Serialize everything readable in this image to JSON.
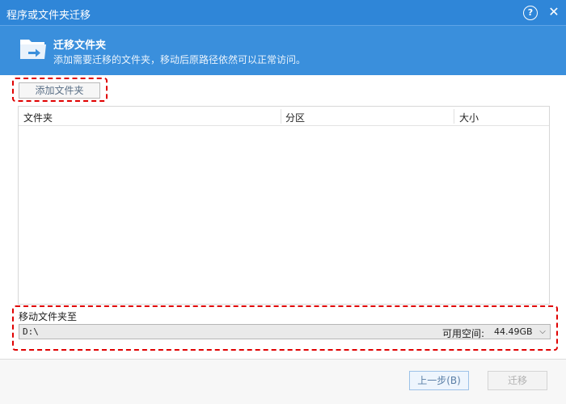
{
  "window": {
    "title": "程序或文件夹迁移",
    "help_icon": "help-circle-icon",
    "close_icon": "close-icon",
    "help_glyph": "?",
    "close_glyph": "✕"
  },
  "banner": {
    "icon": "folder-move-icon",
    "heading": "迁移文件夹",
    "description": "添加需要迁移的文件夹，移动后原路径依然可以正常访问。"
  },
  "toolbar": {
    "add_folder_label": "添加文件夹"
  },
  "folder_list": {
    "columns": [
      "文件夹",
      "分区",
      "大小"
    ],
    "rows": []
  },
  "target": {
    "label": "移动文件夹至",
    "path": "D:\\",
    "free_space_label": "可用空间:",
    "free_space_value": "44.49GB",
    "dropdown_icon": "chevron-down-icon",
    "dropdown_glyph": "⌵"
  },
  "footer": {
    "back_label": "上一步(B)",
    "next_label": "迁移"
  },
  "colors": {
    "titlebar": "#2f86d8",
    "banner": "#3a8fdc",
    "highlight": "#e00000"
  }
}
